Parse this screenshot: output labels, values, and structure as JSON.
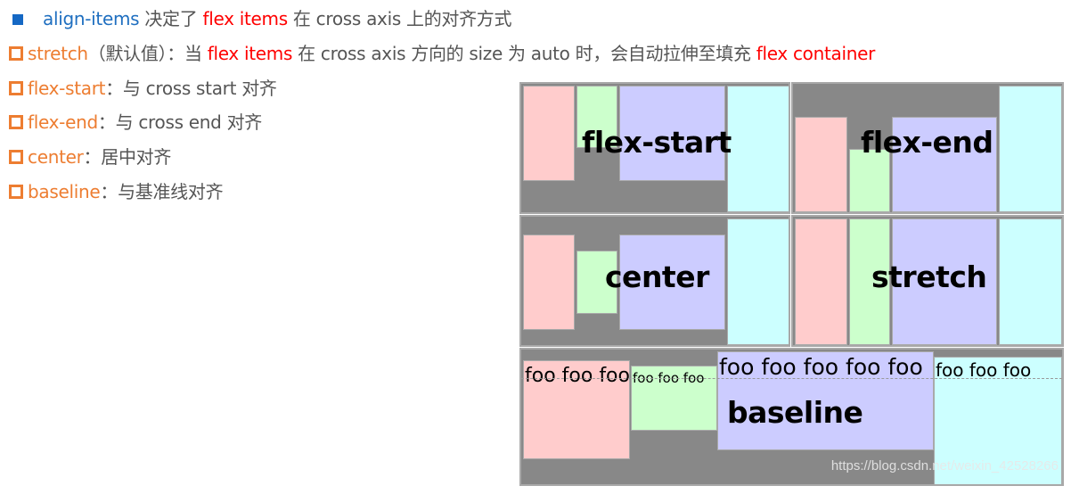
{
  "heading": {
    "bullet_icon": "square-filled-blue",
    "term": "align-items",
    "text1": " 决定了 ",
    "term2": "flex items",
    "text2": " 在 cross axis 上的对齐方式"
  },
  "items": [
    {
      "bullet_icon": "square-outline-orange",
      "term": "stretch",
      "parts": [
        "（默认值）：当 ",
        "flex items",
        " 在 cross axis 方向的 size 为 auto 时，会自动拉伸至填充 ",
        "flex container"
      ]
    },
    {
      "bullet_icon": "square-outline-orange",
      "term": "flex-start",
      "desc": "：与 cross start 对齐"
    },
    {
      "bullet_icon": "square-outline-orange",
      "term": "flex-end",
      "desc": "：与 cross end 对齐"
    },
    {
      "bullet_icon": "square-outline-orange",
      "term": "center",
      "desc": "：居中对齐"
    },
    {
      "bullet_icon": "square-outline-orange",
      "term": "baseline",
      "desc": "：与基准线对齐"
    }
  ],
  "diagram": {
    "panels": [
      {
        "label": "flex-start"
      },
      {
        "label": "flex-end"
      },
      {
        "label": "center"
      },
      {
        "label": "stretch"
      },
      {
        "label": "baseline",
        "foo_texts": [
          "foo foo foo",
          "foo foo foo",
          "foo foo foo foo foo",
          "foo foo foo"
        ]
      }
    ],
    "colors": {
      "container": "#888888",
      "item1": "#ffcccc",
      "item2": "#ccffcc",
      "item3": "#ccccff",
      "item4": "#ccffff"
    }
  },
  "watermark": "https://blog.csdn.net/weixin_42528266"
}
